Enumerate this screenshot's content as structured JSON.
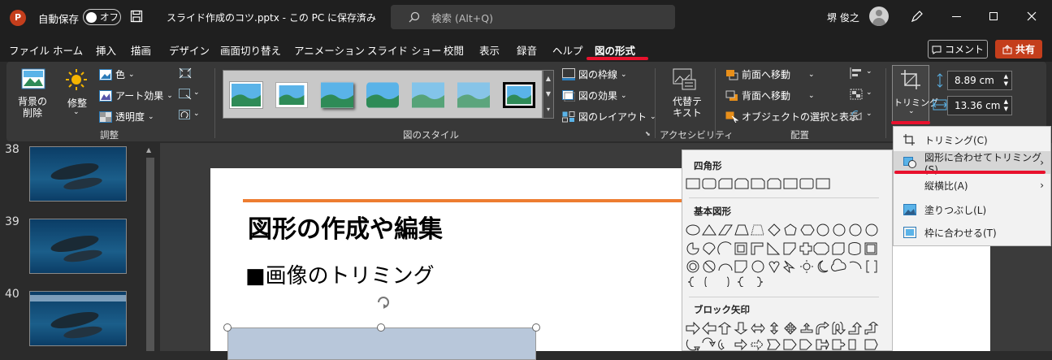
{
  "titlebar": {
    "autosave_label": "自動保存",
    "autosave_state": "オフ",
    "filename": "スライド作成のコツ.pptx - この PC に保存済み",
    "search_placeholder": "検索 (Alt+Q)",
    "user_name": "堺 俊之"
  },
  "menu": {
    "tabs": [
      "ファイル",
      "ホーム",
      "挿入",
      "描画",
      "デザイン",
      "画面切り替え",
      "アニメーション",
      "スライド ショー",
      "校閲",
      "表示",
      "録音",
      "ヘルプ",
      "図の形式"
    ],
    "active_tab": "図の形式",
    "comment_button": "コメント",
    "share_button": "共有"
  },
  "ribbon": {
    "remove_bg_label": "背景の\n削除",
    "correct_label": "修整",
    "color_label": "色",
    "art_effect_label": "アート効果",
    "transparency_label": "透明度",
    "group_adjust": "調整",
    "group_styles": "図のスタイル",
    "border_label": "図の枠線",
    "effect_label": "図の効果",
    "layout_label": "図のレイアウト",
    "alt_text_label": "代替テ\nキスト",
    "group_accessibility": "アクセシビリティ",
    "bring_forward_label": "前面へ移動",
    "send_backward_label": "背面へ移動",
    "selection_pane_label": "オブジェクトの選択と表示",
    "group_arrange": "配置",
    "crop_label": "トリミング",
    "height_value": "8.89 cm",
    "width_value": "13.36 cm"
  },
  "slides": {
    "numbers": [
      "38",
      "39",
      "40"
    ]
  },
  "slide": {
    "title": "図形の作成や編集",
    "bullet": "■画像のトリミング"
  },
  "shape_menu": {
    "cat_rect": "四角形",
    "cat_basic": "基本図形",
    "cat_block_arrow": "ブロック矢印"
  },
  "crop_menu": {
    "items": [
      {
        "label": "トリミング(C)",
        "has_submenu": false
      },
      {
        "label": "図形に合わせてトリミング(S)",
        "has_submenu": true
      },
      {
        "label": "縦横比(A)",
        "has_submenu": true
      },
      {
        "label": "塗りつぶし(L)",
        "has_submenu": false
      },
      {
        "label": "枠に合わせる(T)",
        "has_submenu": false
      }
    ]
  },
  "colors": {
    "accent_red": "#e8112d",
    "share_orange": "#c43e1c",
    "slide_orange": "#ed7d31"
  }
}
